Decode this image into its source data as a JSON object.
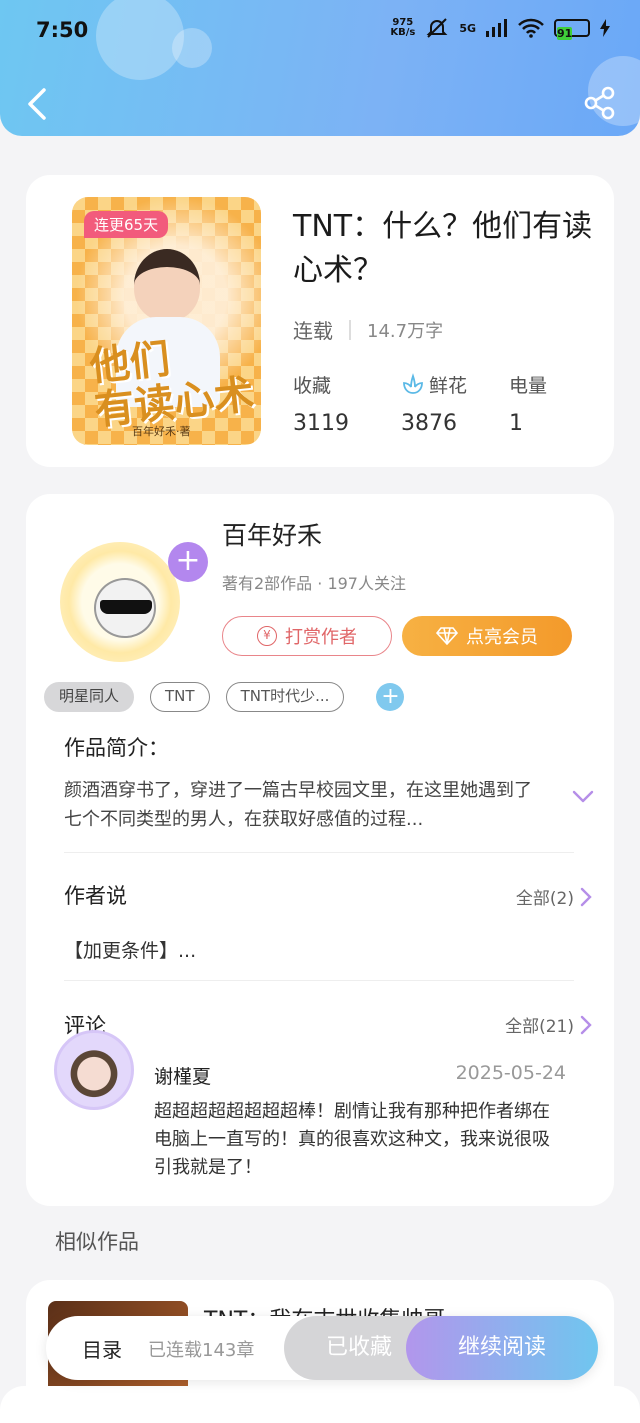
{
  "status_bar": {
    "time": "7:50",
    "net_speed_value": "975",
    "net_speed_unit": "KB/s",
    "network": "5G",
    "battery": "91",
    "icons": [
      "mute-icon",
      "signal-icon",
      "wifi-icon",
      "battery-icon",
      "charging-icon"
    ]
  },
  "header": {
    "back_icon": "chevron-left-icon",
    "share_icon": "share-icon"
  },
  "book": {
    "cover_badge": "连更65天",
    "title": "TNT：什么？他们有读心术？",
    "status": "连载",
    "word_count": "14.7万字",
    "stats": [
      {
        "label": "收藏",
        "value": "3119"
      },
      {
        "label": "鲜花",
        "value": "3876",
        "icon": "flower-icon"
      },
      {
        "label": "电量",
        "value": "1"
      }
    ]
  },
  "author": {
    "name": "百年好禾",
    "summary": "著有2部作品 · 197人关注",
    "tip_button": "打赏作者",
    "vip_button": "点亮会员",
    "follow_icon": "plus-icon"
  },
  "tags": [
    "明星同人",
    "TNT",
    "TNT时代少..."
  ],
  "intro": {
    "heading": "作品简介：",
    "text": "颜酒酒穿书了，穿进了一篇古早校园文里，在这里她遇到了七个不同类型的男人，在获取好感值的过程..."
  },
  "author_says": {
    "heading": "作者说",
    "more": "全部(2)",
    "text": "【加更条件】..."
  },
  "comments": {
    "heading": "评论",
    "more": "全部(21)",
    "items": [
      {
        "user": "谢槿夏",
        "date": "2025-05-24",
        "text": "超超超超超超超超棒！剧情让我有那种把作者绑在电脑上一直写的！真的很喜欢这种文，我来说很吸引我就是了！"
      }
    ]
  },
  "similar": {
    "heading": "相似作品",
    "first_title": "TNT：我在末世收集帅哥"
  },
  "bottom_bar": {
    "toc": "目录",
    "chapters": "已连载143章",
    "favorited": "已收藏",
    "continue": "继续阅读"
  },
  "colors": {
    "header_gradient_start": "#6ec7f2",
    "header_gradient_end": "#6aa8f7",
    "accent_purple": "#b387ee",
    "tip_red": "#e06668",
    "vip_orange": "#f39a2b"
  }
}
